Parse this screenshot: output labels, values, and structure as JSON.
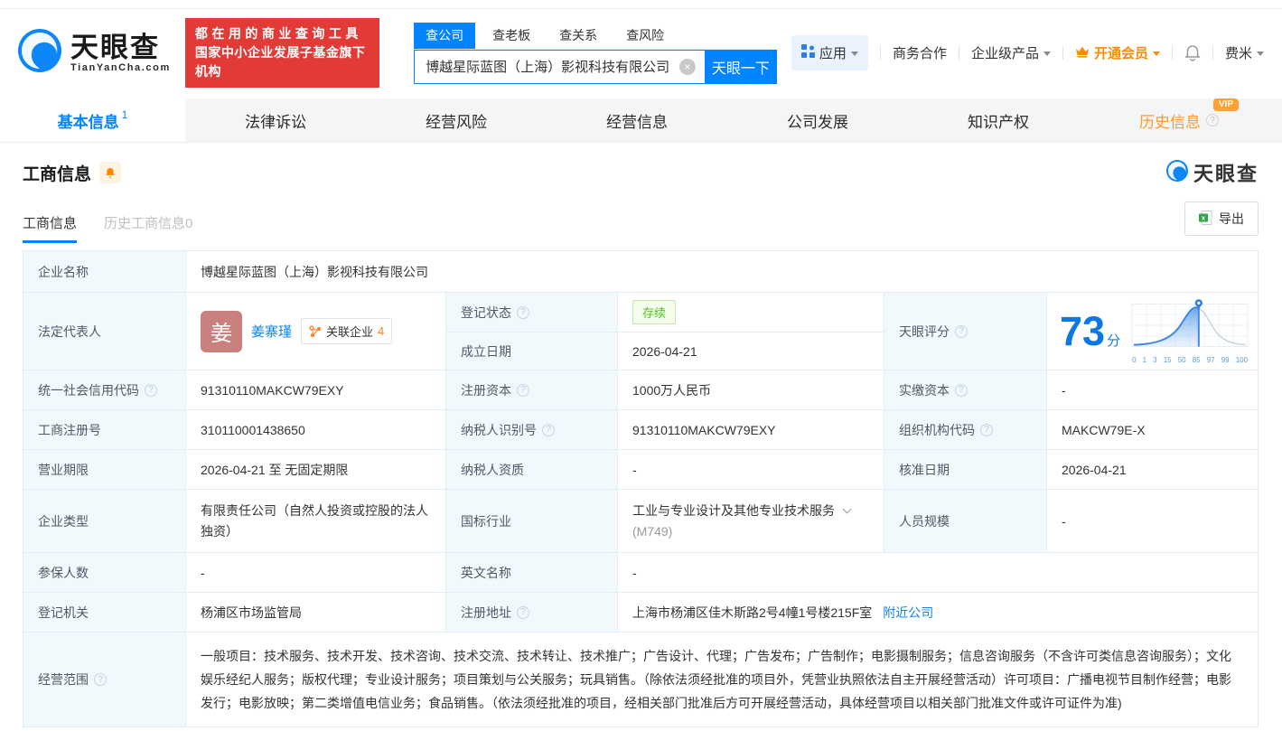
{
  "header": {
    "logo": {
      "brand": "天眼查",
      "domain": "TianYanCha.com"
    },
    "banner": {
      "line1": "都在用的商业查询工具",
      "line2": "国家中小企业发展子基金旗下机构"
    },
    "search": {
      "tabs": [
        {
          "label": "查公司"
        },
        {
          "label": "查老板"
        },
        {
          "label": "查关系"
        },
        {
          "label": "查风险"
        }
      ],
      "value": "博越星际蓝图（上海）影视科技有限公司",
      "clear": "×",
      "button": "天眼一下"
    },
    "menu": {
      "apps": "应用",
      "cooperation": "商务合作",
      "enterprise": "企业级产品",
      "vip": "开通会员",
      "user": "费米"
    }
  },
  "nav": {
    "tabs": [
      {
        "label": "基本信息",
        "count": "1"
      },
      {
        "label": "法律诉讼"
      },
      {
        "label": "经营风险"
      },
      {
        "label": "经营信息"
      },
      {
        "label": "公司发展"
      },
      {
        "label": "知识产权"
      },
      {
        "label": "历史信息",
        "vip": "VIP"
      }
    ]
  },
  "section": {
    "title": "工商信息",
    "subtabs": [
      {
        "label": "工商信息"
      },
      {
        "label": "历史工商信息0"
      }
    ],
    "export_label": "导出",
    "watermark": "天眼查"
  },
  "table": {
    "company_name_label": "企业名称",
    "company_name": "博越星际蓝图（上海）影视科技有限公司",
    "legal_rep_label": "法定代表人",
    "legal_rep": {
      "avatar": "姜",
      "name": "姜寨瑾",
      "related_label": "关联企业",
      "related_count": "4"
    },
    "reg_status_label": "登记状态",
    "reg_status": "存续",
    "est_date_label": "成立日期",
    "est_date": "2026-04-21",
    "score_label": "天眼评分",
    "score": "73",
    "score_unit": "分",
    "score_axis": [
      "0",
      "1",
      "3",
      "15",
      "50",
      "85",
      "97",
      "99",
      "100"
    ],
    "credit_code_label": "统一社会信用代码",
    "credit_code": "91310110MAKCW79EXY",
    "reg_capital_label": "注册资本",
    "reg_capital": "1000万人民币",
    "paid_capital_label": "实缴资本",
    "paid_capital": "-",
    "reg_number_label": "工商注册号",
    "reg_number": "310110001438650",
    "taxpayer_id_label": "纳税人识别号",
    "taxpayer_id": "91310110MAKCW79EXY",
    "org_code_label": "组织机构代码",
    "org_code": "MAKCW79E-X",
    "biz_term_label": "营业期限",
    "biz_term": "2026-04-21 至 无固定期限",
    "taxpayer_quality_label": "纳税人资质",
    "taxpayer_quality": "-",
    "approval_date_label": "核准日期",
    "approval_date": "2026-04-21",
    "company_type_label": "企业类型",
    "company_type": "有限责任公司（自然人投资或控股的法人独资）",
    "industry_label": "国标行业",
    "industry": "工业与专业设计及其他专业技术服务",
    "industry_code": "(M749)",
    "staff_size_label": "人员规模",
    "staff_size": "-",
    "insured_label": "参保人数",
    "insured": "-",
    "english_name_label": "英文名称",
    "english_name": "-",
    "authority_label": "登记机关",
    "authority": "杨浦区市场监管局",
    "address_label": "注册地址",
    "address": "上海市杨浦区佳木斯路2号4幢1号楼215F室",
    "nearby_link": "附近公司",
    "scope_label": "经营范围",
    "scope": "一般项目：技术服务、技术开发、技术咨询、技术交流、技术转让、技术推广；广告设计、代理；广告发布；广告制作；电影摄制服务；信息咨询服务（不含许可类信息咨询服务）；文化娱乐经纪人服务；版权代理；专业设计服务；项目策划与公关服务；玩具销售。（除依法须经批准的项目外，凭营业执照依法自主开展经营活动）许可项目：广播电视节目制作经营；电影发行；电影放映；第二类增值电信业务；食品销售。（依法须经批准的项目，经相关部门批准后方可开展经营活动，具体经营项目以相关部门批准文件或许可证件为准)"
  },
  "colors": {
    "accent_blue": "#0084ff",
    "banner_red": "#e23a36",
    "vip_orange": "#ff8a00",
    "status_green": "#52c41a",
    "label_bg": "#f2f9fd",
    "table_border": "#e3edf5"
  },
  "icons": {
    "logo": "tianyancha-swirl-icon",
    "clear": "clear-circle-icon",
    "apps": "grid-icon",
    "crown": "crown-icon",
    "bell": "bell-icon",
    "question": "question-mark-icon",
    "excel": "excel-icon",
    "relation": "relation-network-icon",
    "chevron": "chevron-down-icon",
    "pin": "map-pin-icon"
  }
}
